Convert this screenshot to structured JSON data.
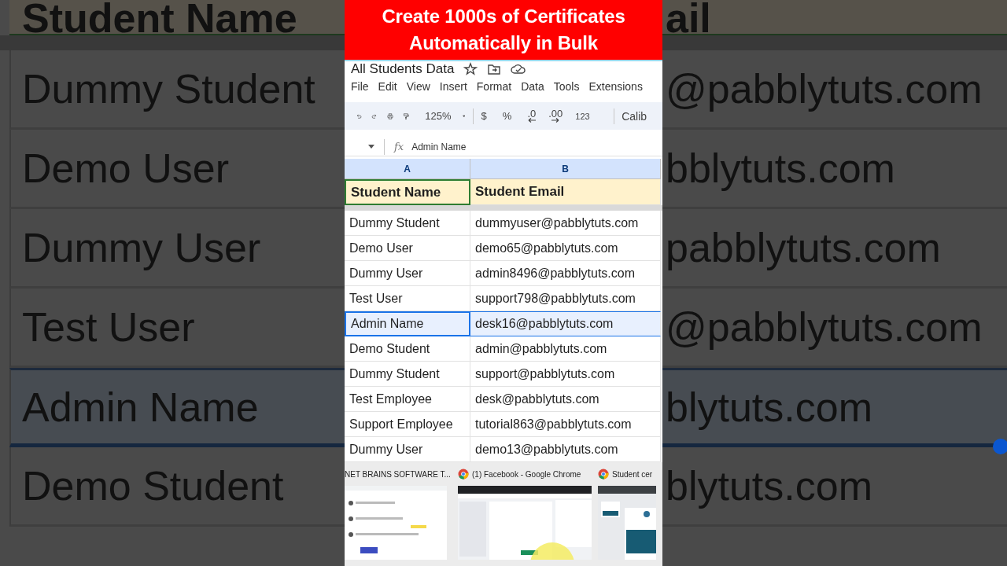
{
  "background_left": {
    "header": "Student Name",
    "rows": [
      {
        "text": "Dummy Student",
        "selected": false
      },
      {
        "text": "Demo User",
        "selected": false
      },
      {
        "text": "Dummy User",
        "selected": false
      },
      {
        "text": "Test User",
        "selected": false
      },
      {
        "text": "Admin Name",
        "selected": true
      },
      {
        "text": "Demo Student",
        "selected": false
      }
    ]
  },
  "banner": {
    "lines": [
      "Create 1000s of Certificates",
      "Automatically in Bulk"
    ]
  },
  "document": {
    "title": "All Students Data"
  },
  "menu": [
    "File",
    "Edit",
    "View",
    "Insert",
    "Format",
    "Data",
    "Tools",
    "Extensions"
  ],
  "toolbar": {
    "zoom": "125%",
    "currency": "$",
    "percent": "%",
    "decrease_decimals": ".0",
    "increase_decimals": ".00",
    "number_format": "123",
    "font": "Calib"
  },
  "formula_bar": {
    "fx": "fx",
    "value": "Admin Name"
  },
  "columns": [
    {
      "label": "A",
      "selected": true
    },
    {
      "label": "B",
      "selected": true
    }
  ],
  "header_row": [
    "Student Name",
    "Student Email"
  ],
  "rows": [
    {
      "cells": [
        "Dummy Student",
        "dummyuser@pabblytuts.com"
      ],
      "selected": false
    },
    {
      "cells": [
        "Demo User",
        "demo65@pabblytuts.com"
      ],
      "selected": false
    },
    {
      "cells": [
        "Dummy User",
        "admin8496@pabblytuts.com"
      ],
      "selected": false
    },
    {
      "cells": [
        "Test User",
        "support798@pabblytuts.com"
      ],
      "selected": false
    },
    {
      "cells": [
        "Admin Name",
        "desk16@pabblytuts.com"
      ],
      "selected": true
    },
    {
      "cells": [
        "Demo Student",
        "admin@pabblytuts.com"
      ],
      "selected": false
    },
    {
      "cells": [
        "Dummy Student",
        "support@pabblytuts.com"
      ],
      "selected": false
    },
    {
      "cells": [
        "Test Employee",
        "desk@pabblytuts.com"
      ],
      "selected": false
    },
    {
      "cells": [
        "Support Employee",
        "tutorial863@pabblytuts.com"
      ],
      "selected": false
    },
    {
      "cells": [
        "Dummy User",
        "demo13@pabblytuts.com"
      ],
      "selected": false
    }
  ],
  "taskbar": [
    {
      "title": "NET BRAINS SOFTWARE T...",
      "kind": "plain"
    },
    {
      "title": "(1) Facebook - Google Chrome",
      "kind": "browser"
    },
    {
      "title": "Student cer",
      "kind": "browser"
    }
  ],
  "background_right": {
    "header": "ail",
    "rows": [
      {
        "text": "@pabblytuts.com",
        "selected": false
      },
      {
        "text": "bblytuts.com",
        "selected": false
      },
      {
        "text": "pabblytuts.com",
        "selected": false
      },
      {
        "text": "@pabblytuts.com",
        "selected": false
      },
      {
        "text": "blytuts.com",
        "selected": true
      },
      {
        "text": "blytuts.com",
        "selected": false
      }
    ]
  }
}
